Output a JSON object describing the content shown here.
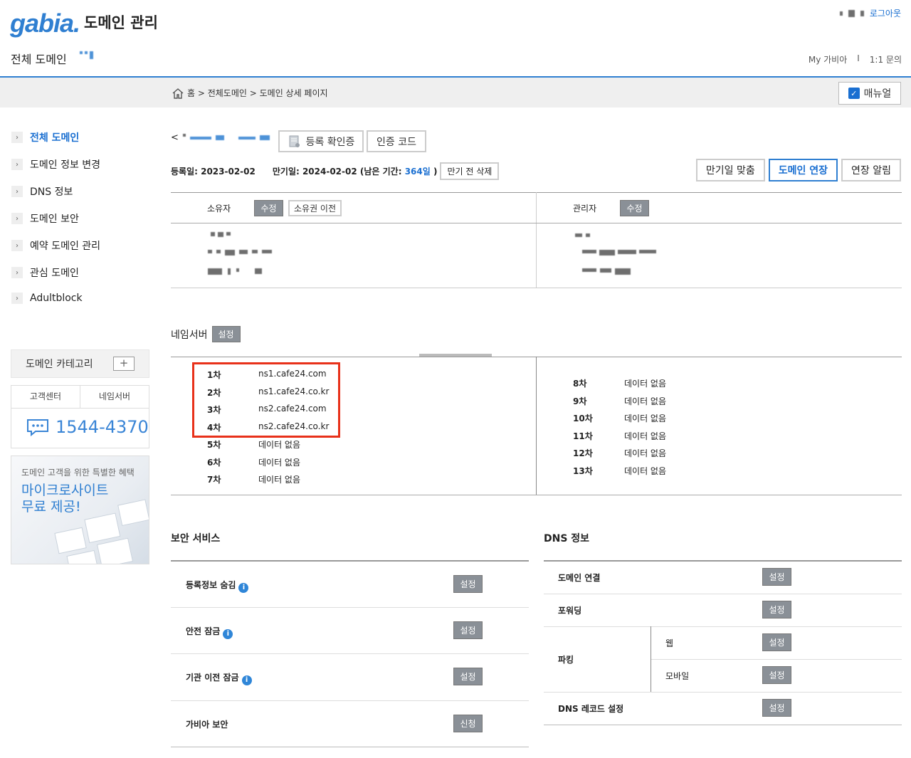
{
  "header": {
    "logo": "gabia.",
    "app_title": "도메인 관리",
    "logout": "로그아웃",
    "sub_title": "전체 도메인",
    "links": [
      "My 가비아",
      "I",
      "1:1 문의"
    ],
    "breadcrumb": "홈 > 전체도메인 > 도메인 상세 페이지",
    "manual": "매뉴얼"
  },
  "sidebar": {
    "items": [
      {
        "label": "전체 도메인",
        "active": true
      },
      {
        "label": "도메인 정보 변경"
      },
      {
        "label": "DNS 정보"
      },
      {
        "label": "도메인 보안"
      },
      {
        "label": "예약 도메인 관리"
      },
      {
        "label": "관심 도메인"
      },
      {
        "label": "Adultblock"
      }
    ],
    "category": "도메인 카테고리",
    "cs_tabs": [
      "고객센터",
      "네임서버"
    ],
    "phone": "1544-4370",
    "promo_small": "도메인 고객을 위한 특별한 혜택",
    "promo_big_1": "마이크로사이트",
    "promo_big_2": "무료 제공!"
  },
  "domain": {
    "back": "<",
    "cert_button": "등록 확인증",
    "code_button": "인증 코드",
    "reg_label": "등록일: 2023-02-02",
    "exp_label": "만기일: 2024-02-02 (남은 기간: ",
    "remaining": "364일",
    "exp_close": ")",
    "delete_button": "만기 전 삭제",
    "btn_match": "만기일 맞춤",
    "btn_extend": "도메인 연장",
    "btn_notify": "연장 알림"
  },
  "contacts": {
    "owner": "소유자",
    "admin": "관리자",
    "edit": "수정",
    "transfer": "소유권 이전"
  },
  "nameserver": {
    "title": "네임서버",
    "set": "설정",
    "left": [
      {
        "k": "1차",
        "v": "ns1.cafe24.com"
      },
      {
        "k": "2차",
        "v": "ns1.cafe24.co.kr"
      },
      {
        "k": "3차",
        "v": "ns2.cafe24.com"
      },
      {
        "k": "4차",
        "v": "ns2.cafe24.co.kr"
      },
      {
        "k": "5차",
        "v": "데이터 없음"
      },
      {
        "k": "6차",
        "v": "데이터 없음"
      },
      {
        "k": "7차",
        "v": "데이터 없음"
      }
    ],
    "right": [
      {
        "k": "8차",
        "v": "데이터 없음"
      },
      {
        "k": "9차",
        "v": "데이터 없음"
      },
      {
        "k": "10차",
        "v": "데이터 없음"
      },
      {
        "k": "11차",
        "v": "데이터 없음"
      },
      {
        "k": "12차",
        "v": "데이터 없음"
      },
      {
        "k": "13차",
        "v": "데이터 없음"
      }
    ]
  },
  "security": {
    "title": "보안 서비스",
    "rows": [
      {
        "label": "등록정보 숨김",
        "btn": "설정",
        "info": true
      },
      {
        "label": "안전 잠금",
        "btn": "설정",
        "info": true
      },
      {
        "label": "기관 이전 잠금",
        "btn": "설정",
        "info": true
      },
      {
        "label": "가비아 보안",
        "btn": "신청",
        "info": false
      }
    ]
  },
  "dns": {
    "title": "DNS 정보",
    "connect": "도메인 연결",
    "forward": "포워딩",
    "parking": "파킹",
    "web": "웹",
    "mobile": "모바일",
    "record": "DNS 레코드 설정",
    "set": "설정"
  }
}
